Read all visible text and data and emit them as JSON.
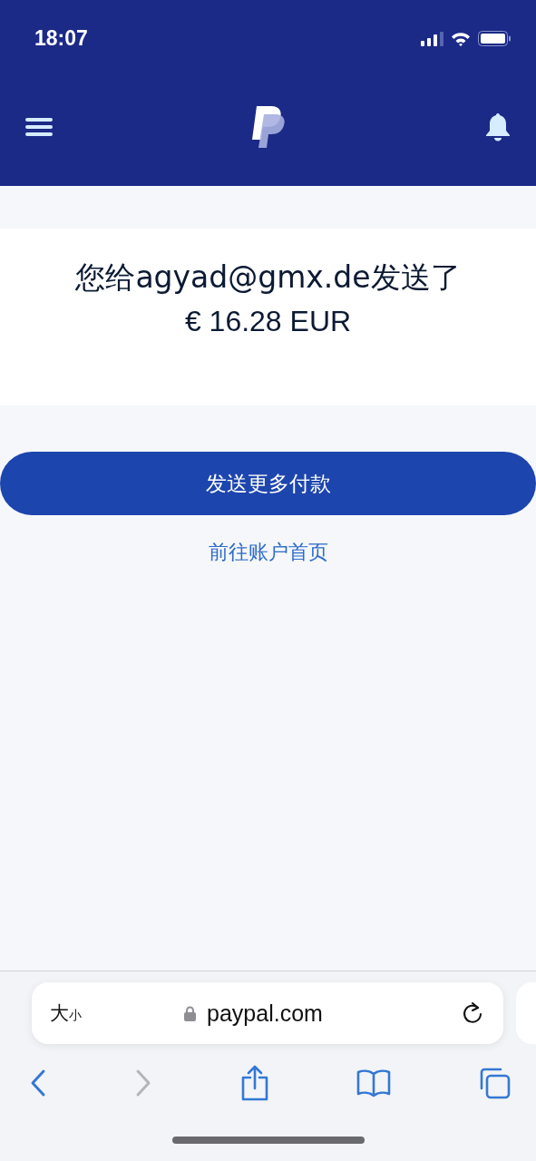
{
  "status_bar": {
    "time": "18:07"
  },
  "confirmation": {
    "message": "您给agyad@gmx.de发送了",
    "amount": "€ 16.28 EUR"
  },
  "actions": {
    "primary_button": "发送更多付款",
    "link": "前往账户首页"
  },
  "browser": {
    "text_size": {
      "large": "大",
      "small": "小"
    },
    "url": "paypal.com"
  },
  "toolbar": [
    {
      "kind": "back",
      "disabled": false
    },
    {
      "kind": "forward",
      "disabled": true
    },
    {
      "kind": "share",
      "disabled": false
    },
    {
      "kind": "bookmarks",
      "disabled": false
    },
    {
      "kind": "tabs",
      "disabled": false
    }
  ]
}
